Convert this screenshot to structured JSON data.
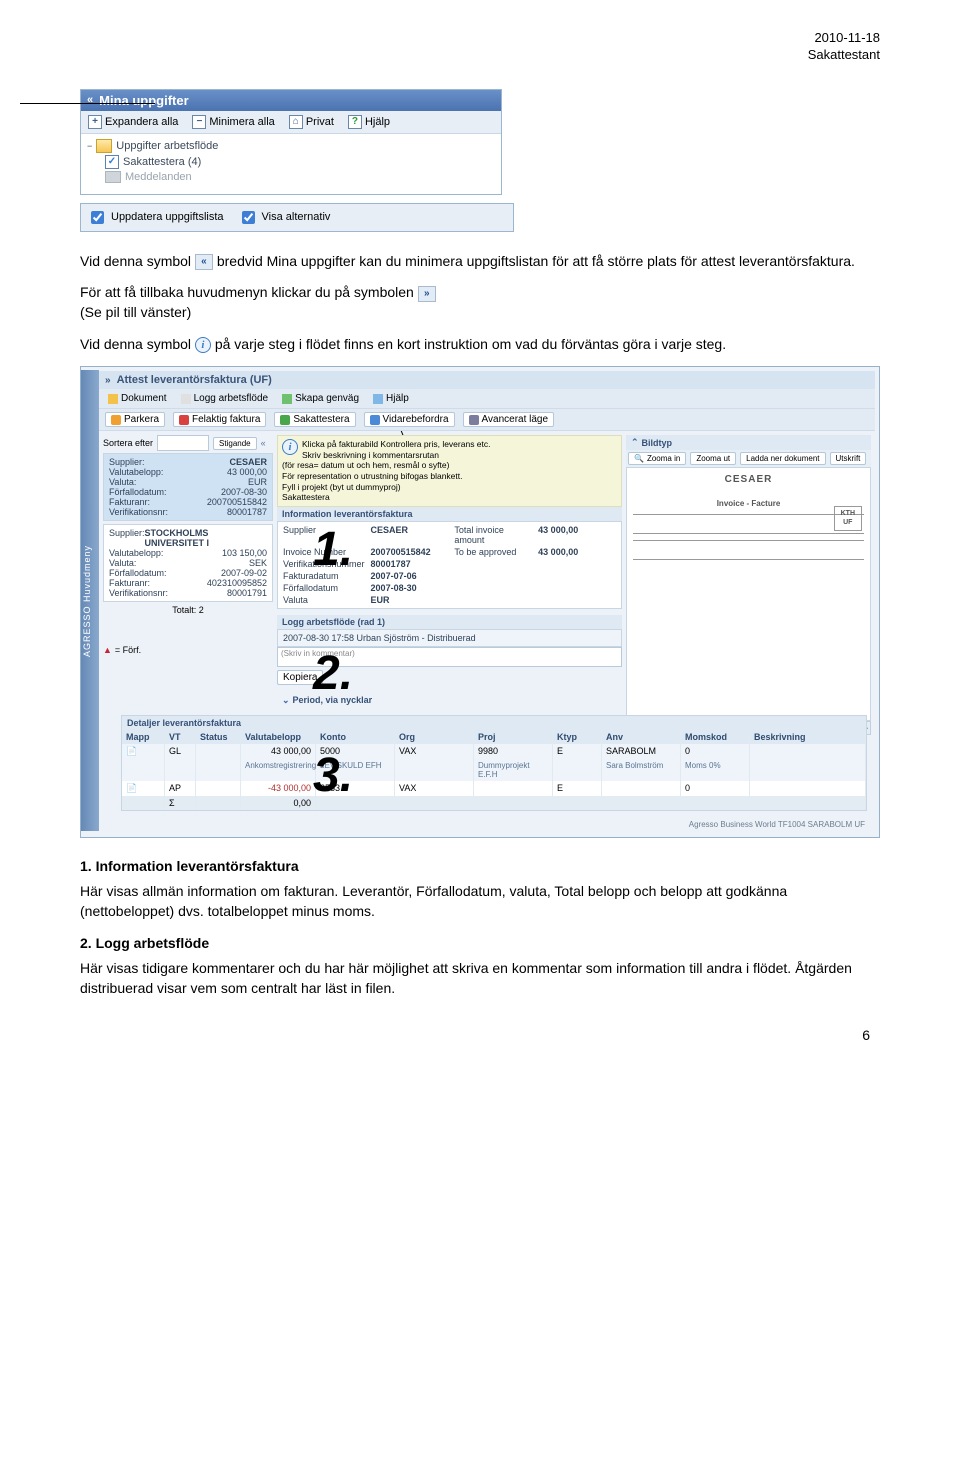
{
  "header": {
    "date": "2010-11-18",
    "role": "Sakattestant"
  },
  "sidebar": {
    "title": "Mina uppgifter",
    "toolbar": {
      "expand": "Expandera alla",
      "minimize": "Minimera alla",
      "private": "Privat",
      "help": "Hjälp"
    },
    "tree": {
      "root": "Uppgifter arbetsflöde",
      "item1": "Sakattestera (4)",
      "item2": "Meddelanden"
    }
  },
  "checkbar": {
    "refresh": "Uppdatera uppgiftslista",
    "show_alt": "Visa alternativ"
  },
  "para1": {
    "a": "Vid denna symbol ",
    "b": " bredvid Mina uppgifter kan du minimera uppgiftslistan för att få större plats för attest leverantörsfaktura.",
    "c": "För att få tillbaka huvudmenyn klickar du på symbolen",
    "d": " (Se pil till vänster)",
    "e": "Vid denna symbol ",
    "f": " på varje steg i flödet finns en kort instruktion om vad du förväntas göra i varje steg."
  },
  "bigshot": {
    "left_tab": "AGRESSO Huvudmeny",
    "title": "Attest leverantörsfaktura (UF)",
    "row1": {
      "doc": "Dokument",
      "log": "Logg arbetsflöde",
      "shortcut": "Skapa genväg",
      "help": "Hjälp"
    },
    "row2": {
      "park": "Parkera",
      "wrong": "Felaktig faktura",
      "attest": "Sakattestera",
      "forward": "Vidarebefordra",
      "advanced": "Avancerat läge"
    },
    "sort_label": "Sortera efter",
    "asc": "Stigande",
    "inv1": {
      "supplier_l": "Supplier:",
      "supplier_v": "CESAER",
      "amount_l": "Valutabelopp:",
      "amount_v": "43 000,00",
      "curr_l": "Valuta:",
      "curr_v": "EUR",
      "due_l": "Förfallodatum:",
      "due_v": "2007-08-30",
      "invno_l": "Fakturanr:",
      "invno_v": "200700515842",
      "verif_l": "Verifikationsnr:",
      "verif_v": "80001787"
    },
    "inv2": {
      "supplier_l": "Supplier:",
      "supplier_v": "STOCKHOLMS UNIVERSITET I",
      "amount_l": "Valutabelopp:",
      "amount_v": "103 150,00",
      "curr_l": "Valuta:",
      "curr_v": "SEK",
      "due_l": "Förfallodatum:",
      "due_v": "2007-09-02",
      "invno_l": "Fakturanr:",
      "invno_v": "402310095852",
      "verif_l": "Verifikationsnr:",
      "verif_v": "80001791"
    },
    "total_label": "Totalt: 2",
    "forf": "= Förf.",
    "note": {
      "l1": "Klicka på fakturabild Kontrollera pris, leverans etc.",
      "l2": "Skriv beskrivning i kommentarsrutan",
      "l3": "(för resa= datum ut och hem, resmål o syfte)",
      "l4": "För representation o utrustning bifogas blankett.",
      "l5": "Fyll i projekt (byt ut dummyproj)",
      "l6": "Sakattestera"
    },
    "info_title": "Information leverantörsfaktura",
    "info": {
      "supplier_l": "Supplier",
      "supplier_v": "CESAER",
      "total_l": "Total invoice amount",
      "total_v": "43 000,00",
      "invno_l": "Invoice Number",
      "invno_v": "200700515842",
      "appr_l": "To be approved",
      "appr_v": "43 000,00",
      "verif_l": "Verifikationsnummer",
      "verif_v": "80001787",
      "date_l": "Fakturadatum",
      "date_v": "2007-07-06",
      "due_l": "Förfallodatum",
      "due_v": "2007-08-30",
      "curr_l": "Valuta",
      "curr_v": "EUR"
    },
    "log_title": "Logg arbetsflöde (rad 1)",
    "log_entry": "2007-08-30 17:58 Urban Sjöström - Distribuerad",
    "comment_placeholder": "(Skriv in kommentar)",
    "copy": "Kopiera",
    "period": "Period, via nycklar",
    "img_title": "Bildtyp",
    "img_btns": {
      "zoomin": "Zooma in",
      "zoomout": "Zooma ut",
      "download": "Ladda ner dokument",
      "print": "Utskrift"
    },
    "doc_name": "CESAER",
    "doc_sub": "Invoice - Facture",
    "details_title": "Detaljer leverantörsfaktura",
    "thead": {
      "mapp": "Mapp",
      "vt": "VT",
      "status": "Status",
      "valuta": "Valutabelopp",
      "konto": "Konto",
      "org": "Org",
      "proj": "Proj",
      "ktyp": "Ktyp",
      "anv": "Anv",
      "moms": "Momskod",
      "beskr": "Beskrivning"
    },
    "tr1": {
      "mapp": "",
      "vt": "GL",
      "valuta": "43 000,00",
      "konto": "5000",
      "org": "VAX",
      "proj": "9980",
      "ktyp": "E",
      "anv": "SARABOLM",
      "moms": "0",
      "sub1": "Ankomstregistrering",
      "sub2": "LEV.SKULD EFH",
      "sub3": "Dummyprojekt E.F.H",
      "sub4": "Sara Bolmström",
      "sub5": "Moms 0%"
    },
    "tr2": {
      "vt": "AP",
      "valuta": "-43 000,00",
      "konto": "2583",
      "org": "VAX",
      "ktyp": "E",
      "moms": "0"
    },
    "tr3": {
      "vt": "Σ",
      "valuta": "0,00"
    },
    "footer": "Agresso Business World  TF1004  SARABOLM  UF"
  },
  "nums": {
    "n1": "1.",
    "n2": "2.",
    "n3": "3."
  },
  "section1_title": "1. Information leverantörsfaktura",
  "section1_body": "Här visas allmän information om fakturan. Leverantör, Förfallodatum, valuta, Total belopp och belopp att godkänna (nettobeloppet) dvs. totalbeloppet minus moms.",
  "section2_title": "2. Logg arbetsflöde",
  "section2_body": "Här visas tidigare kommentarer och du har här möjlighet att skriva en kommentar som information till andra i flödet. Åtgärden distribuerad visar vem som centralt har läst in filen.",
  "page_num": "6"
}
